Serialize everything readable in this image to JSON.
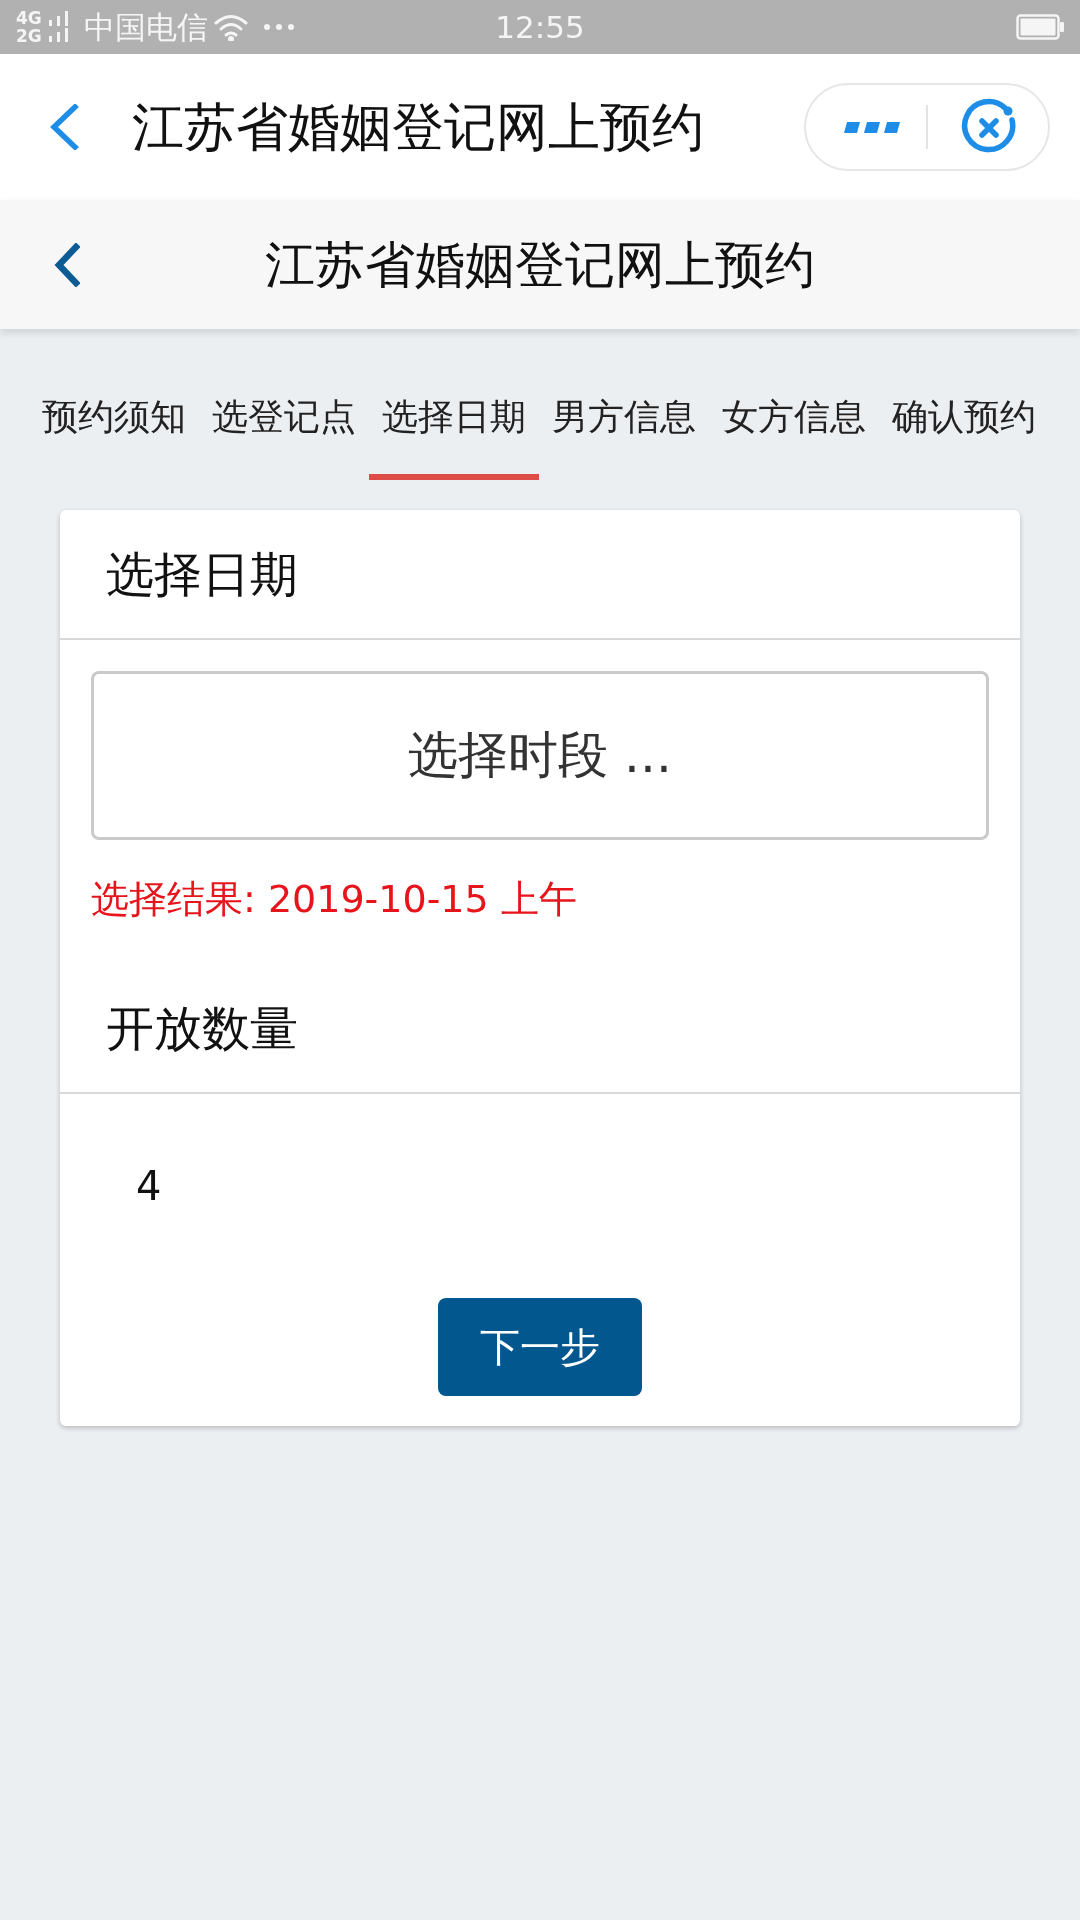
{
  "status_bar": {
    "network": [
      "4G",
      "2G"
    ],
    "carrier": "中国电信",
    "time": "12:55"
  },
  "mini_program_bar": {
    "title": "江苏省婚姻登记网上预约"
  },
  "page_header": {
    "title": "江苏省婚姻登记网上预约"
  },
  "steps": [
    {
      "label": "预约须知",
      "selected": false
    },
    {
      "label": "选登记点",
      "selected": false
    },
    {
      "label": "选择日期",
      "selected": true
    },
    {
      "label": "男方信息",
      "selected": false
    },
    {
      "label": "女方信息",
      "selected": false
    },
    {
      "label": "确认预约",
      "selected": false
    }
  ],
  "card": {
    "date_section": {
      "title": "选择日期",
      "time_slot_button": "选择时段 ...",
      "result": "选择结果: 2019-10-15 上午"
    },
    "quota_section": {
      "title": "开放数量",
      "value": "4"
    },
    "next_button": "下一步"
  }
}
